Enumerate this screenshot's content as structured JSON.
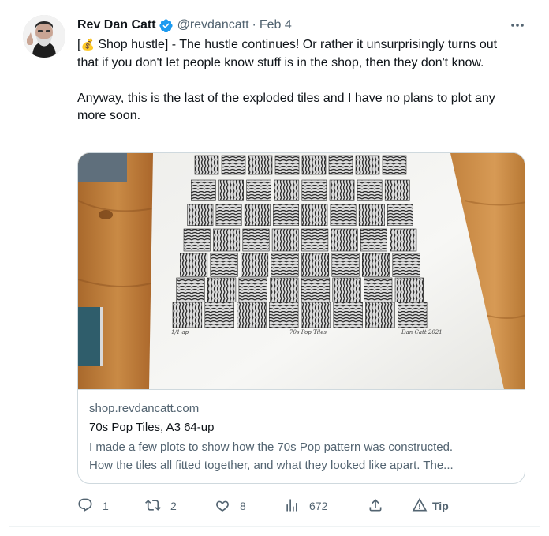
{
  "tweet": {
    "author_name": "Rev Dan Catt",
    "handle": "@revdancatt",
    "separator": "·",
    "date": "Feb 4",
    "text_prefix": "[",
    "emoji": "💰",
    "text_body": " Shop hustle] - The hustle continues! Or rather it unsurprisingly turns out that if you don't let people know stuff is in the shop, then they don't know.\n\nAnyway, this is the last of the exploded tiles and I have no plans to plot any more soon."
  },
  "card": {
    "domain": "shop.revdancatt.com",
    "title": "70s Pop Tiles, A3 64-up",
    "desc_line1": "I made a few plots to show how the 70s Pop pattern was constructed.",
    "desc_line2": "How the tiles all fitted together, and what they looked like apart. The...",
    "image_caption_left": "1/1 ap",
    "image_caption_center": "70s Pop Tiles",
    "image_signature": "Dan Catt 2021"
  },
  "actions": {
    "replies": "1",
    "retweets": "2",
    "likes": "8",
    "views": "672",
    "tip": "Tip"
  },
  "icons": [
    "verified-badge-icon",
    "more-icon",
    "reply-icon",
    "retweet-icon",
    "like-icon",
    "views-icon",
    "share-icon",
    "tip-icon"
  ],
  "colors": {
    "verified": "#1d9bf0",
    "secondary_text": "#536471",
    "border": "#cfd9de"
  }
}
